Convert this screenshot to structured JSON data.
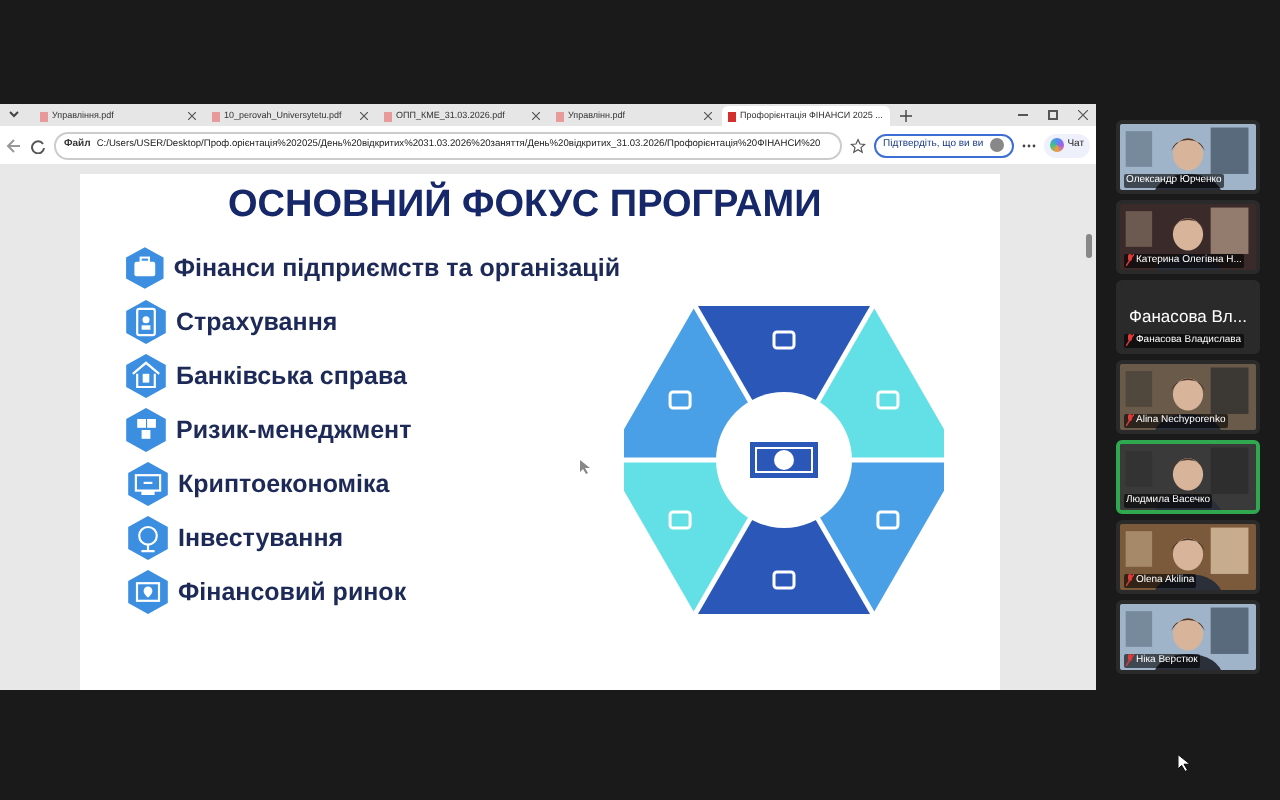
{
  "browser": {
    "tabs": [
      {
        "label": "Управління.pdf",
        "selected": false
      },
      {
        "label": "10_perovah_Universytetu.pdf",
        "selected": false
      },
      {
        "label": "ОПП_КМЕ_31.03.2026.pdf",
        "selected": false
      },
      {
        "label": "Управлінн.pdf",
        "selected": false
      },
      {
        "label": "Профорієнтація ФІНАНСИ 2025 ...",
        "selected": true
      }
    ],
    "address": {
      "scheme": "Файл",
      "url": "C:/Users/USER/Desktop/Проф.орієнтація%202025/День%20відкритих%2031.03.2026%20заняття/День%20відкритих_31.03.2026/Профорієнтація%20ФІНАНСИ%20"
    },
    "profile_button": "Підтвердіть, що ви ви",
    "chat_button": "Чат"
  },
  "slide": {
    "title": "ОСНОВНИЙ ФОКУС ПРОГРАМИ",
    "items": [
      "Фінанси підприємств та організацій",
      "Страхування",
      "Банківська справа",
      "Ризик-менеджмент",
      "Криптоекономіка",
      "Інвестування",
      "Фінансовий ринок"
    ]
  },
  "participants": [
    {
      "kind": "video",
      "name": "Олександр Юрченко",
      "muted": false,
      "speaking": false
    },
    {
      "kind": "video",
      "name": "Катерина Олегівна Н...",
      "muted": true,
      "speaking": false
    },
    {
      "kind": "name_only",
      "big_name": "Фанасова Вл...",
      "name": "Фанасова Владислава",
      "muted": true,
      "speaking": false
    },
    {
      "kind": "video",
      "name": "Alina Nechyporenko",
      "muted": true,
      "speaking": false
    },
    {
      "kind": "video",
      "name": "Людмила Васечко",
      "muted": false,
      "speaking": true
    },
    {
      "kind": "video",
      "name": "Olena Akilina",
      "muted": true,
      "speaking": false
    },
    {
      "kind": "video",
      "name": "Ніка Верстюк",
      "muted": true,
      "speaking": false
    }
  ]
}
